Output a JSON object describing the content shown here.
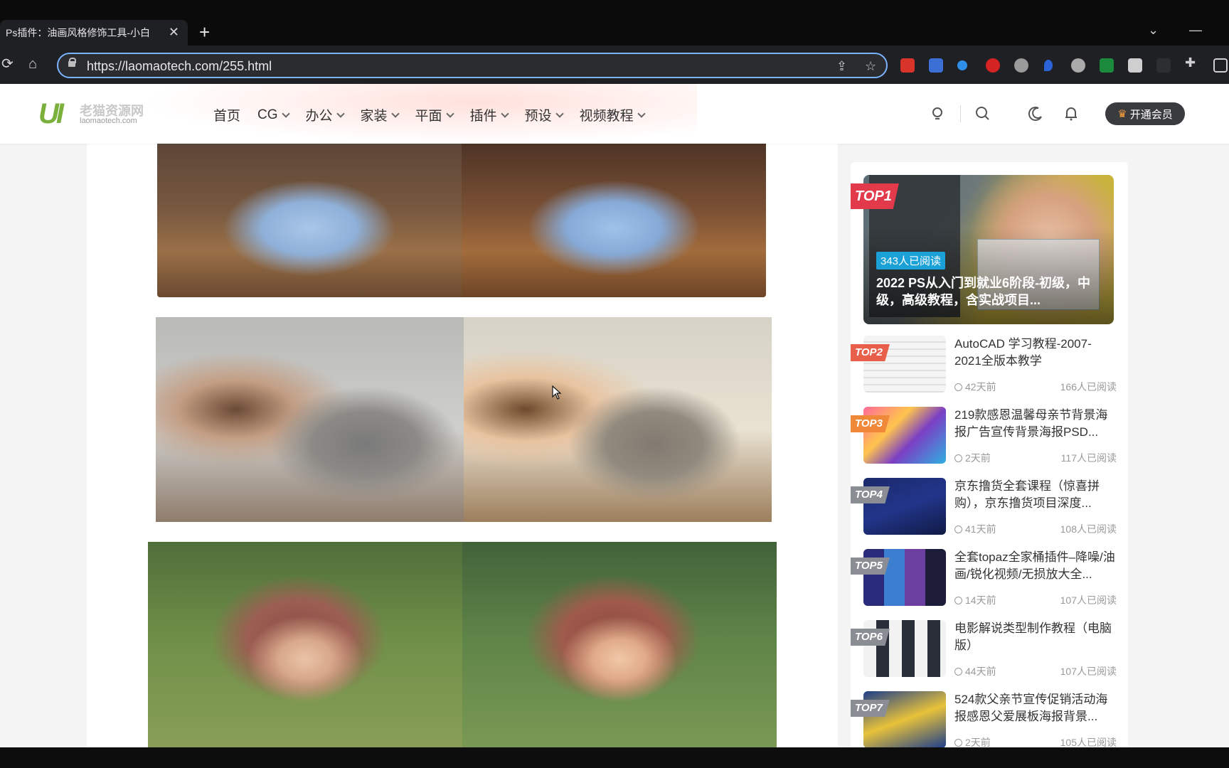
{
  "browser": {
    "tab_title": "Ps插件：油画风格修饰工具-小白",
    "tab_close": "✕",
    "new_tab": "+",
    "url": "https://laomaotech.com/255.html"
  },
  "site": {
    "logo_mark": "UI",
    "logo_cn": "老猫资源网",
    "logo_en": "laomaotech.com",
    "nav": [
      {
        "label": "首页",
        "dropdown": false
      },
      {
        "label": "CG",
        "dropdown": true
      },
      {
        "label": "办公",
        "dropdown": true
      },
      {
        "label": "家装",
        "dropdown": true
      },
      {
        "label": "平面",
        "dropdown": true
      },
      {
        "label": "插件",
        "dropdown": true
      },
      {
        "label": "预设",
        "dropdown": true
      },
      {
        "label": "视频教程",
        "dropdown": true
      }
    ],
    "vip_button": "开通会员"
  },
  "sidebar": {
    "top1": {
      "rank": "TOP1",
      "reads": "343人已阅读",
      "title": "2022 PS从入门到就业6阶段-初级，中级，高级教程，含实战项目..."
    },
    "items": [
      {
        "rank": "TOP2",
        "title": "AutoCAD 学习教程-2007-2021全版本教学",
        "time": "42天前",
        "views": "166人已阅读",
        "color": "#e8604c"
      },
      {
        "rank": "TOP3",
        "title": "219款感恩温馨母亲节背景海报广告宣传背景海报PSD...",
        "time": "2天前",
        "views": "117人已阅读",
        "color": "#f0883a"
      },
      {
        "rank": "TOP4",
        "title": "京东撸货全套课程（惊喜拼购），京东撸货项目深度...",
        "time": "41天前",
        "views": "108人已阅读",
        "color": "#8a8d93"
      },
      {
        "rank": "TOP5",
        "title": "全套topaz全家桶插件–降噪/油画/锐化视频/无损放大全...",
        "time": "14天前",
        "views": "107人已阅读",
        "color": "#8a8d93"
      },
      {
        "rank": "TOP6",
        "title": "电影解说类型制作教程（电脑版）",
        "time": "44天前",
        "views": "107人已阅读",
        "color": "#8a8d93"
      },
      {
        "rank": "TOP7",
        "title": "524款父亲节宣传促销活动海报感恩父爱展板海报背景...",
        "time": "2天前",
        "views": "105人已阅读",
        "color": "#8a8d93"
      }
    ]
  },
  "colors": {
    "accent_blue": "#7ab3ff",
    "logo_green": "#7bb03c",
    "top1_red": "#e23a4a",
    "read_badge": "#1ba1d8"
  }
}
